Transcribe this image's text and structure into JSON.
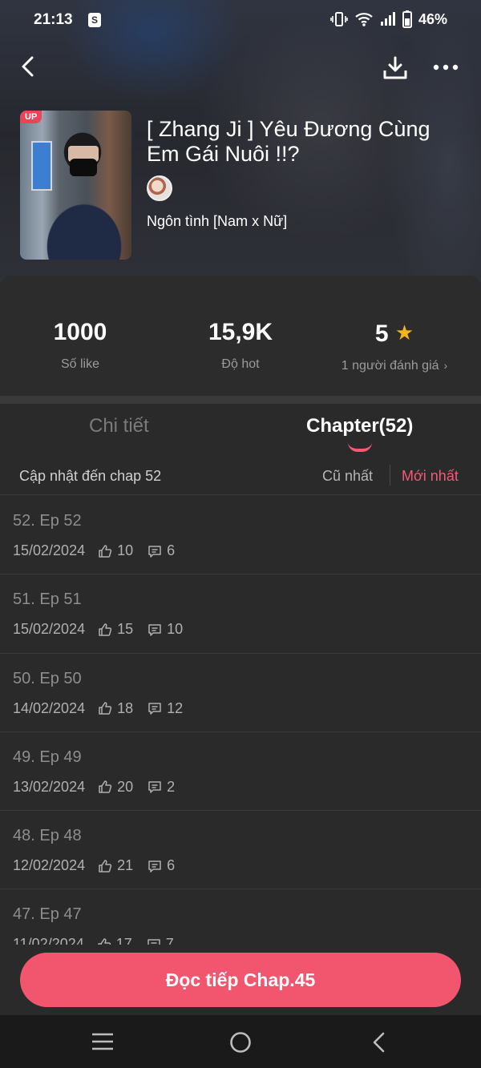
{
  "status": {
    "time": "21:13",
    "battery": "46%",
    "shop_icon": "S"
  },
  "book": {
    "title": "[ Zhang Ji ] Yêu Đương Cùng Em Gái Nuôi !!?",
    "genre": "Ngôn tình [Nam x Nữ]",
    "badge": "UP"
  },
  "stats": [
    {
      "value": "1000",
      "label": "Số like"
    },
    {
      "value": "15,9K",
      "label": "Độ hot"
    },
    {
      "value": "5",
      "label": "1 người đánh giá"
    }
  ],
  "tabs": {
    "detail": "Chi tiết",
    "chapter": "Chapter(52)"
  },
  "sort": {
    "update": "Cập nhật đến chap 52",
    "old": "Cũ nhất",
    "new": "Mới nhất"
  },
  "chapters": [
    {
      "title": "52. Ep 52",
      "date": "15/02/2024",
      "likes": "10",
      "comments": "6"
    },
    {
      "title": "51. Ep 51",
      "date": "15/02/2024",
      "likes": "15",
      "comments": "10"
    },
    {
      "title": "50. Ep 50",
      "date": "14/02/2024",
      "likes": "18",
      "comments": "12"
    },
    {
      "title": "49. Ep 49",
      "date": "13/02/2024",
      "likes": "20",
      "comments": "2"
    },
    {
      "title": "48. Ep 48",
      "date": "12/02/2024",
      "likes": "21",
      "comments": "6"
    },
    {
      "title": "47. Ep 47",
      "date": "11/02/2024",
      "likes": "17",
      "comments": "7"
    }
  ],
  "continue_label": "Đọc tiếp Chap.45",
  "colors": {
    "accent": "#f2566f",
    "star": "#f5b31c",
    "background": "#2a2a2a"
  },
  "icons": [
    "back-icon",
    "download-icon",
    "more-icon",
    "star-icon",
    "like-icon",
    "comment-icon",
    "menu-icon",
    "home-icon",
    "nav-back-icon"
  ]
}
